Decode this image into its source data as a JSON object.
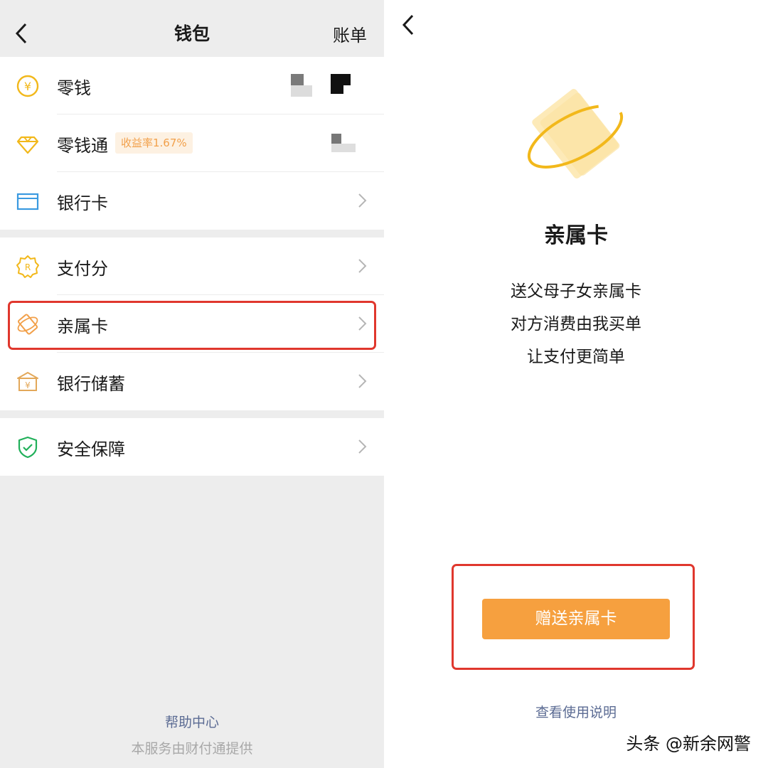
{
  "wallet": {
    "title": "钱包",
    "bills_label": "账单",
    "group1": [
      {
        "label": "零钱",
        "icon": "yen-coin-icon"
      },
      {
        "label": "零钱通",
        "icon": "diamond-icon",
        "badge": "收益率1.67%"
      },
      {
        "label": "银行卡",
        "icon": "bank-card-icon"
      }
    ],
    "group2": [
      {
        "label": "支付分",
        "icon": "credit-score-icon"
      },
      {
        "label": "亲属卡",
        "icon": "family-card-icon",
        "highlighted": true
      },
      {
        "label": "银行储蓄",
        "icon": "bank-savings-icon"
      }
    ],
    "group3": [
      {
        "label": "安全保障",
        "icon": "shield-check-icon"
      }
    ],
    "help_label": "帮助中心",
    "provider_text": "本服务由财付通提供"
  },
  "family_card": {
    "title": "亲属卡",
    "description": [
      "送父母子女亲属卡",
      "对方消费由我买单",
      "让支付更简单"
    ],
    "gift_button": "赠送亲属卡",
    "guide_link": "查看使用说明"
  },
  "watermark": "头条 @新余网警",
  "colors": {
    "accent_orange": "#f6a03f",
    "highlight_red": "#e0372d",
    "link_blue": "#5b6b93",
    "icon_gold": "#f2b81b",
    "icon_blue": "#3a9ae0",
    "icon_green": "#21b05a",
    "badge_text": "#f2a04a"
  }
}
